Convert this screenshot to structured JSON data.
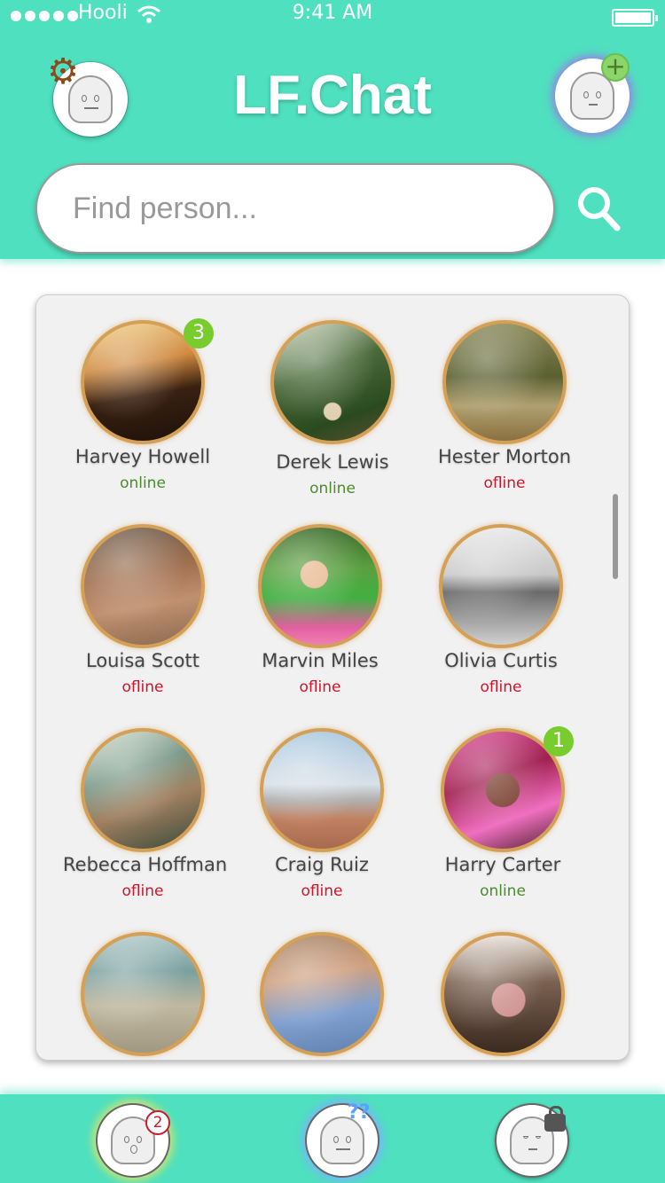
{
  "status_bar": {
    "carrier": "Hooli",
    "time": "9:41 AM"
  },
  "header": {
    "title": "LF.Chat"
  },
  "search": {
    "placeholder": "Find person..."
  },
  "contacts": [
    {
      "name": "Harvey Howell",
      "status": "online",
      "unread": "3"
    },
    {
      "name": "Derek Lewis",
      "status": "online",
      "unread": ""
    },
    {
      "name": "Hester Morton",
      "status": "ofline",
      "unread": ""
    },
    {
      "name": "Louisa Scott",
      "status": "ofline",
      "unread": ""
    },
    {
      "name": "Marvin Miles",
      "status": "ofline",
      "unread": ""
    },
    {
      "name": "Olivia Curtis",
      "status": "ofline",
      "unread": ""
    },
    {
      "name": "Rebecca Hoffman",
      "status": "ofline",
      "unread": ""
    },
    {
      "name": "Craig Ruiz",
      "status": "ofline",
      "unread": ""
    },
    {
      "name": "Harry Carter",
      "status": "online",
      "unread": "1"
    },
    {
      "name": "",
      "status": "",
      "unread": ""
    },
    {
      "name": "",
      "status": "",
      "unread": ""
    },
    {
      "name": "",
      "status": "",
      "unread": ""
    }
  ],
  "bottom_nav": {
    "notifications_badge": "2"
  },
  "colors": {
    "accent": "#4fe0bf",
    "online": "#4a8c2a",
    "offline": "#d0142a",
    "unread_badge": "#78cc2e",
    "photo_ring": "#d4a055"
  },
  "icons": [
    "settings-gear-icon",
    "add-contact-icon",
    "search-icon",
    "notifications-icon",
    "help-icon",
    "lock-icon"
  ]
}
